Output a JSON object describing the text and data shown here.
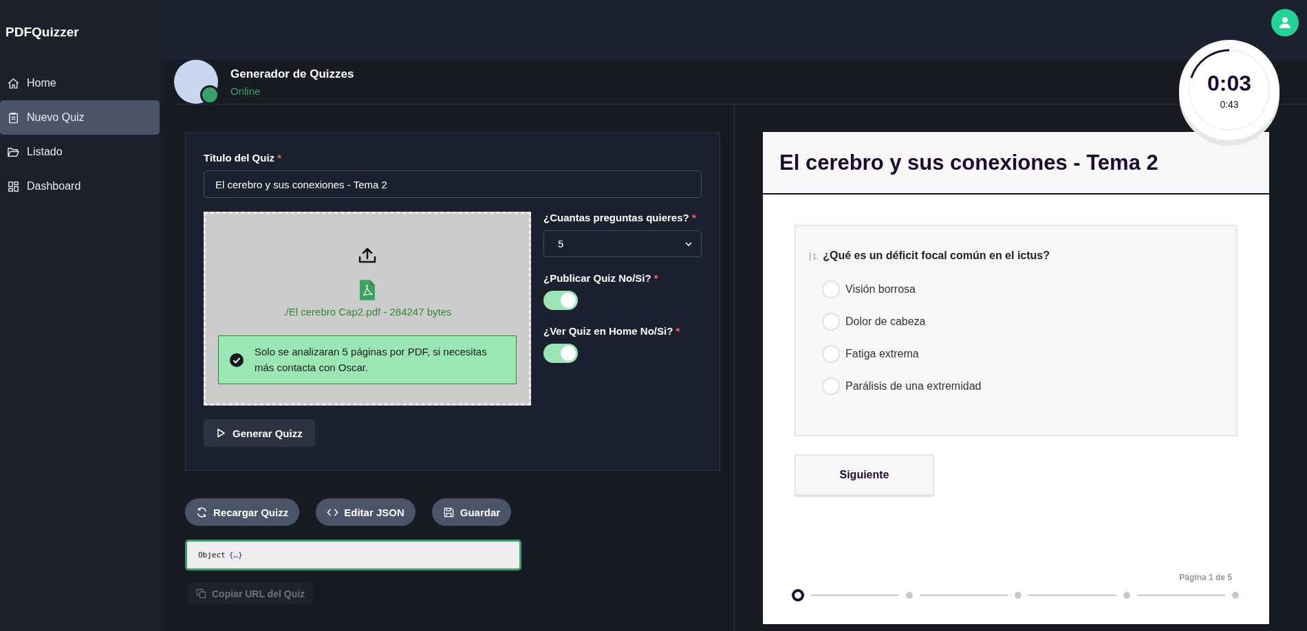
{
  "sidebar": {
    "brand": "PDFQuizzer",
    "items": [
      {
        "label": "Home",
        "selected": false
      },
      {
        "label": "Nuevo Quiz",
        "selected": true
      },
      {
        "label": "Listado",
        "selected": false
      },
      {
        "label": "Dashboard",
        "selected": false
      }
    ]
  },
  "header": {
    "title": "Generador de Quizzes",
    "status": "Online"
  },
  "form": {
    "title_field": {
      "label": "Titulo del Quiz",
      "required_mark": "*",
      "value": "El cerebro y sus conexiones - Tema 2"
    },
    "upload": {
      "file_text": "./El cerebro Cap2.pdf - 284247 bytes",
      "notice": "Solo se analizaran 5 páginas por PDF, si necesitas más contacta con Oscar."
    },
    "question_count": {
      "label": "¿Cuantas preguntas quieres?",
      "required_mark": "*",
      "value": "5"
    },
    "toggles": [
      {
        "label": "¿Publicar Quiz No/Si?",
        "required_mark": "*",
        "on": true
      },
      {
        "label": "¿Ver Quiz en Home No/Si?",
        "required_mark": "*",
        "on": true
      }
    ],
    "generate_button": "Generar Quizz"
  },
  "actions": [
    "Recargar Quizz",
    "Editar JSON",
    "Guardar"
  ],
  "json_viewer": {
    "text": "Object",
    "collapsed": "{…}"
  },
  "copy_button": {
    "label": "Copiar URL del Quiz",
    "disabled": true
  },
  "quiz": {
    "title": "El cerebro y sus conexiones - Tema 2",
    "question": {
      "number": "1.",
      "text": "¿Qué es un déficit focal común en el ictus?",
      "options": [
        {
          "label": "Visión borrosa",
          "selected": false
        },
        {
          "label": "Dolor de cabeza",
          "selected": false
        },
        {
          "label": "Fatiga extrema",
          "selected": false
        },
        {
          "label": "Parálisis de una extremidad",
          "selected": false
        }
      ]
    },
    "next_button": "Siguiente",
    "page_indicator": "Página 1 de 5",
    "steps": [
      {
        "selected": true
      },
      {
        "selected": false
      },
      {
        "selected": false
      },
      {
        "selected": false
      },
      {
        "selected": false
      }
    ]
  },
  "timer": {
    "elapsed": "0:03",
    "total": "0:43",
    "level": 0.2
  }
}
